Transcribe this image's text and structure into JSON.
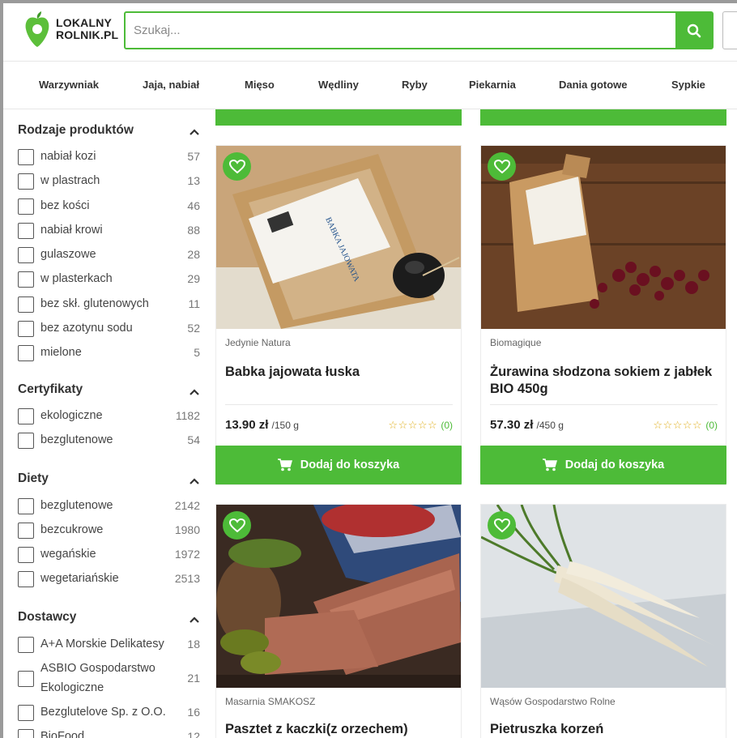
{
  "header": {
    "logo_line1": "LOKALNY",
    "logo_line2": "ROLNIK.PL",
    "search_placeholder": "Szukaj...",
    "brand_color": "#4dbb38"
  },
  "nav": {
    "items": [
      "Warzywniak",
      "Jaja, nabiał",
      "Mięso",
      "Wędliny",
      "Ryby",
      "Piekarnia",
      "Dania gotowe",
      "Sypkie"
    ]
  },
  "filters": {
    "groups": [
      {
        "title": "Rodzaje produktów",
        "options": [
          {
            "label": "nabiał kozi",
            "count": "57"
          },
          {
            "label": "w plastrach",
            "count": "13"
          },
          {
            "label": "bez kości",
            "count": "46"
          },
          {
            "label": "nabiał krowi",
            "count": "88"
          },
          {
            "label": "gulaszowe",
            "count": "28"
          },
          {
            "label": "w plasterkach",
            "count": "29"
          },
          {
            "label": "bez skł. glutenowych",
            "count": "11"
          },
          {
            "label": "bez azotynu sodu",
            "count": "52"
          },
          {
            "label": "mielone",
            "count": "5"
          }
        ]
      },
      {
        "title": "Certyfikaty",
        "options": [
          {
            "label": "ekologiczne",
            "count": "1182"
          },
          {
            "label": "bezglutenowe",
            "count": "54"
          }
        ]
      },
      {
        "title": "Diety",
        "options": [
          {
            "label": "bezglutenowe",
            "count": "2142"
          },
          {
            "label": "bezcukrowe",
            "count": "1980"
          },
          {
            "label": "wegańskie",
            "count": "1972"
          },
          {
            "label": "wegetariańskie",
            "count": "2513"
          }
        ]
      },
      {
        "title": "Dostawcy",
        "options": [
          {
            "label": "A+A Morskie Delikatesy",
            "count": "18"
          },
          {
            "label": "ASBIO Gospodarstwo Ekologiczne",
            "count": "21"
          },
          {
            "label": "Bezglutelove Sp. z O.O.",
            "count": "16"
          },
          {
            "label": "BioFood",
            "count": "12"
          }
        ]
      }
    ]
  },
  "products": [
    {
      "producer": "Jedynie Natura",
      "name": "Babka jajowata łuska",
      "price": "13.90 zł",
      "unit": "/150 g",
      "stars": "☆☆☆☆☆",
      "rating_count": "(0)",
      "cart_label": "Dodaj do koszyka",
      "image": "bag-of-psyllium-husk"
    },
    {
      "producer": "Biomagique",
      "name": "Żurawina słodzona sokiem z jabłek BIO 450g",
      "price": "57.30 zł",
      "unit": "/450 g",
      "stars": "☆☆☆☆☆",
      "rating_count": "(0)",
      "cart_label": "Dodaj do koszyka",
      "image": "bag-of-dried-cranberries"
    },
    {
      "producer": "Masarnia SMAKOSZ",
      "name": "Pasztet z kaczki(z orzechem)",
      "image": "sliced-pate"
    },
    {
      "producer": "Wąsów Gospodarstwo Rolne",
      "name": "Pietruszka korzeń",
      "image": "parsley-roots"
    }
  ]
}
